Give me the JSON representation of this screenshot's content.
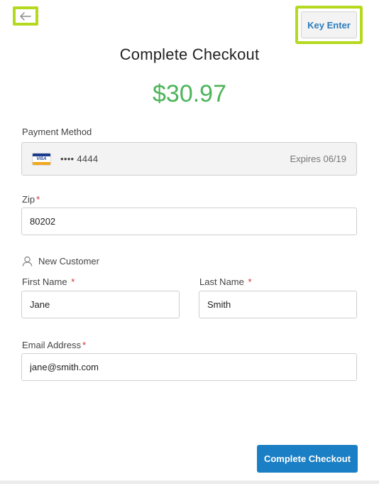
{
  "header": {
    "back_icon": "arrow-left-icon",
    "key_enter_label": "Key Enter"
  },
  "title": "Complete Checkout",
  "amount": "$30.97",
  "payment": {
    "label": "Payment Method",
    "card_icon": "visa-card-icon",
    "card_brand": "VISA",
    "masked_number": "•••• 4444",
    "expires": "Expires 06/19"
  },
  "zip": {
    "label": "Zip",
    "required_mark": "*",
    "value": "80202"
  },
  "customer": {
    "icon": "user-icon",
    "label": "New Customer"
  },
  "first_name": {
    "label": "First Name",
    "required_mark": "*",
    "value": "Jane"
  },
  "last_name": {
    "label": "Last Name",
    "required_mark": "*",
    "value": "Smith"
  },
  "email": {
    "label": "Email Address",
    "required_mark": "*",
    "value": "jane@smith.com"
  },
  "submit_label": "Complete Checkout",
  "colors": {
    "highlight": "#b5d91e",
    "amount": "#4cb45a",
    "primary": "#1a7fc4",
    "required": "#d0312d"
  }
}
